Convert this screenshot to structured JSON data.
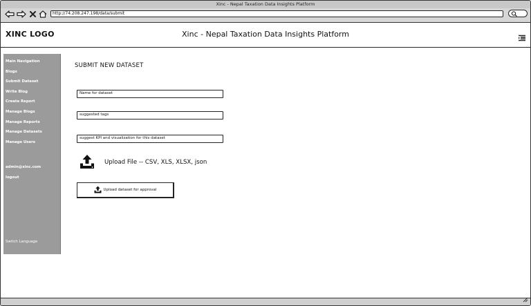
{
  "window": {
    "title": "Xinc - Nepal Taxation Data Insights Platform"
  },
  "browser": {
    "url": "http://74.208.247.198/data/submit",
    "icons": [
      "back-arrow-icon",
      "forward-arrow-icon",
      "stop-icon",
      "home-icon",
      "search-icon"
    ]
  },
  "header": {
    "logo": "XINC LOGO",
    "title": "Xinc - Nepal Taxation Data Insights Platform",
    "menu_icon": "hamburger-menu-icon"
  },
  "sidebar": {
    "items": [
      {
        "label": "Main Navigation"
      },
      {
        "label": "Blogs"
      },
      {
        "label": "Submit Dataset"
      },
      {
        "label": "Write Blog"
      },
      {
        "label": "Create Report"
      },
      {
        "label": "Manage Blogs"
      },
      {
        "label": "Manage Reports"
      },
      {
        "label": "Manage Datasets"
      },
      {
        "label": "Manage Users"
      }
    ],
    "user_email": "admin@xinc.com",
    "logout": "logout",
    "switch_language": "Switch Language"
  },
  "main": {
    "title": "SUBMIT NEW DATASET",
    "name_field": {
      "value": "Name for dataset"
    },
    "tags_field": {
      "value": "suggested tags"
    },
    "kpi_field": {
      "value": "suggest KPI and visualization for this dataset"
    },
    "upload_label": "Upload File -- CSV, XLS, XLSX, json",
    "submit_button": "Upload dataset for approval"
  },
  "colors": {
    "sidebar_bg": "#9b9b9b",
    "chrome_bg": "#d6d6d6",
    "text": "#111111"
  }
}
